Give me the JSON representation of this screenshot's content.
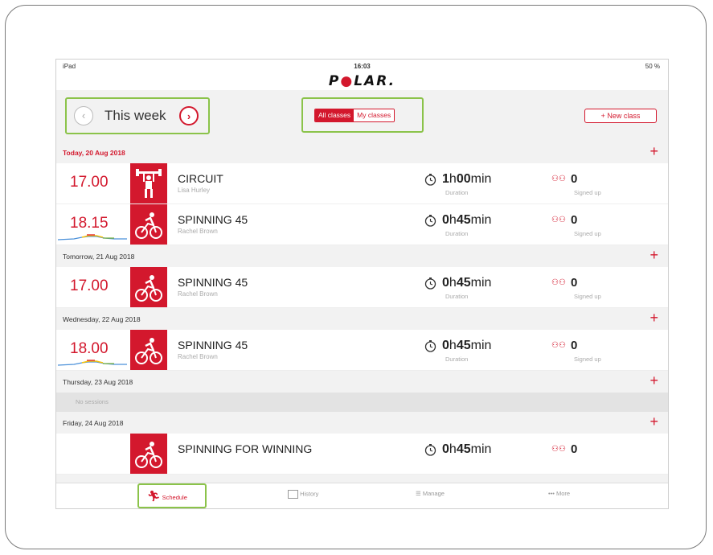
{
  "status_bar": {
    "device": "iPad",
    "time": "16:03",
    "battery": "50 %"
  },
  "brand": {
    "logo_text": "POLAR.",
    "accent": "#d3182d",
    "highlight": "#8bc34a"
  },
  "week_nav": {
    "label": "This week",
    "prev_icon": "chevron-left-icon",
    "next_icon": "chevron-right-icon"
  },
  "filter": {
    "all_label": "All classes",
    "mine_label": "My classes",
    "selected": "All classes"
  },
  "new_class_label": "+ New class",
  "days": [
    {
      "label": "Today, 20 Aug 2018",
      "sessions": [
        {
          "time": "17.00",
          "name": "CIRCUIT",
          "instructor": "Lisa Hurley",
          "dur_h": "1",
          "dur_m": "00",
          "duration_caption": "Duration",
          "signed": "0",
          "signed_caption": "Signed up",
          "icon": "weightlifting-icon"
        },
        {
          "time": "18.15",
          "name": "SPINNING 45",
          "instructor": "Rachel Brown",
          "dur_h": "0",
          "dur_m": "45",
          "duration_caption": "Duration",
          "signed": "0",
          "signed_caption": "Signed up",
          "icon": "cycling-icon"
        }
      ]
    },
    {
      "label": "Tomorrow, 21 Aug 2018",
      "sessions": [
        {
          "time": "17.00",
          "name": "SPINNING 45",
          "instructor": "Rachel Brown",
          "dur_h": "0",
          "dur_m": "45",
          "duration_caption": "Duration",
          "signed": "0",
          "signed_caption": "Signed up",
          "icon": "cycling-icon"
        }
      ]
    },
    {
      "label": "Wednesday, 22 Aug 2018",
      "sessions": [
        {
          "time": "18.00",
          "name": "SPINNING 45",
          "instructor": "Rachel Brown",
          "dur_h": "0",
          "dur_m": "45",
          "duration_caption": "Duration",
          "signed": "0",
          "signed_caption": "Signed up",
          "icon": "cycling-icon"
        }
      ]
    },
    {
      "label": "Thursday, 23 Aug 2018",
      "empty_text": "No sessions"
    },
    {
      "label": "Friday, 24 Aug 2018",
      "sessions": [
        {
          "time": "",
          "name": "SPINNING FOR WINNING",
          "instructor": "",
          "dur_h": "0",
          "dur_m": "45",
          "duration_caption": "",
          "signed": "0",
          "signed_caption": "",
          "icon": "cycling-icon"
        }
      ]
    }
  ],
  "units": {
    "hours": "h",
    "minutes": "min"
  },
  "tabs": [
    {
      "label": "Schedule",
      "icon": "running-icon",
      "selected": true
    },
    {
      "label": "History",
      "icon": "calendar-icon",
      "selected": false
    },
    {
      "label": "Manage",
      "icon": "list-icon",
      "selected": false
    },
    {
      "label": "More",
      "icon": "more-icon",
      "selected": false
    }
  ]
}
